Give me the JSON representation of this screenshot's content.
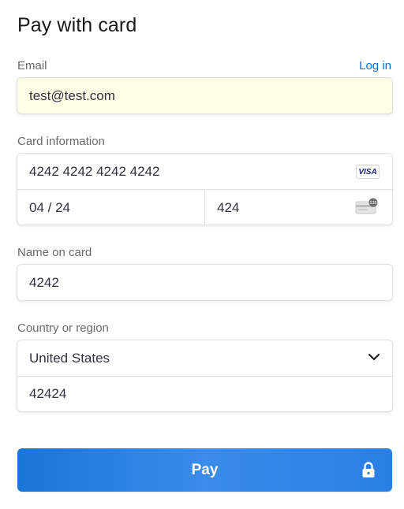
{
  "header": {
    "title": "Pay with card"
  },
  "email": {
    "label": "Email",
    "login_link": "Log in",
    "value": "test@test.com"
  },
  "card": {
    "label": "Card information",
    "number": "4242 4242 4242 4242",
    "brand": "VISA",
    "expiry": "04 / 24",
    "cvc": "424",
    "cvc_icon_badge": "135"
  },
  "name": {
    "label": "Name on card",
    "value": "4242"
  },
  "address": {
    "label": "Country or region",
    "country": "United States",
    "zip": "42424"
  },
  "pay_button": {
    "label": "Pay"
  },
  "icons": {
    "brand": "visa-card-icon",
    "cvc": "cvc-card-icon",
    "dropdown": "chevron-down-icon",
    "lock": "lock-icon"
  },
  "colors": {
    "accent": "#0570de",
    "pay_button": "#2a7fe3",
    "email_autofill_bg": "#fefde5"
  }
}
